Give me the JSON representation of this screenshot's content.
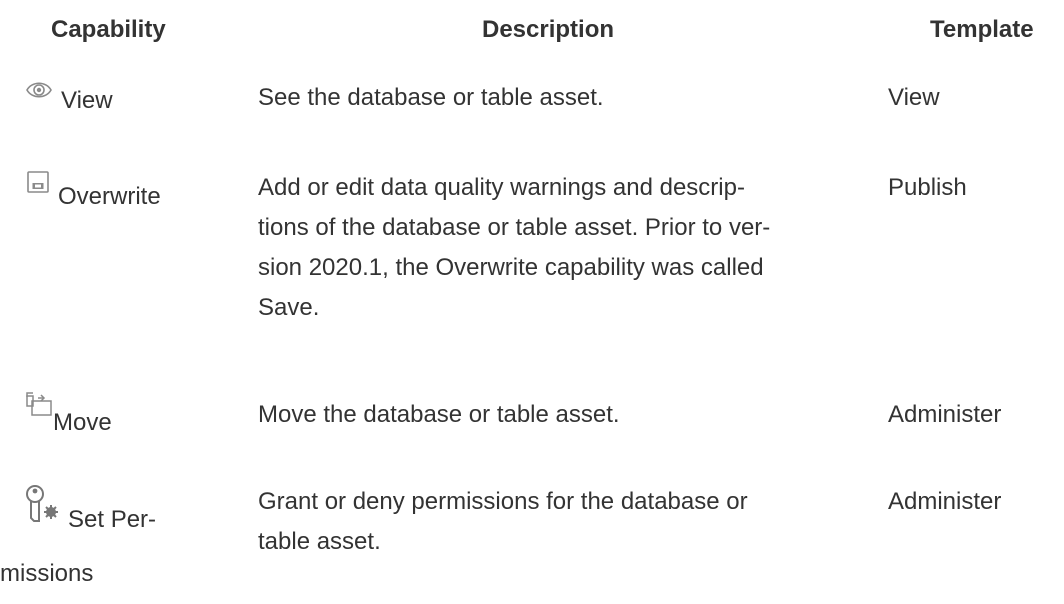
{
  "table": {
    "headers": {
      "capability": "Capability",
      "description": "Description",
      "template": "Template"
    },
    "rows": [
      {
        "icon": "eye-icon",
        "capability": "View",
        "description_lines": [
          "See the database or table asset."
        ],
        "template": "View"
      },
      {
        "icon": "save-icon",
        "capability": "Overwrite",
        "description_lines": [
          "Add or edit data quality warnings and descrip-",
          "tions of the database or table asset. Prior to ver-",
          "sion 2020.1, the Overwrite capability was called",
          "Save."
        ],
        "template": "Publish"
      },
      {
        "icon": "move-icon",
        "capability": "Move",
        "description_lines": [
          "Move the database or table asset."
        ],
        "template": "Administer"
      },
      {
        "icon": "key-gear-icon",
        "capability_lines": [
          "Set Per-",
          "missions"
        ],
        "description_lines": [
          "Grant or deny permissions for the database or",
          "table asset."
        ],
        "template": "Administer"
      }
    ]
  }
}
